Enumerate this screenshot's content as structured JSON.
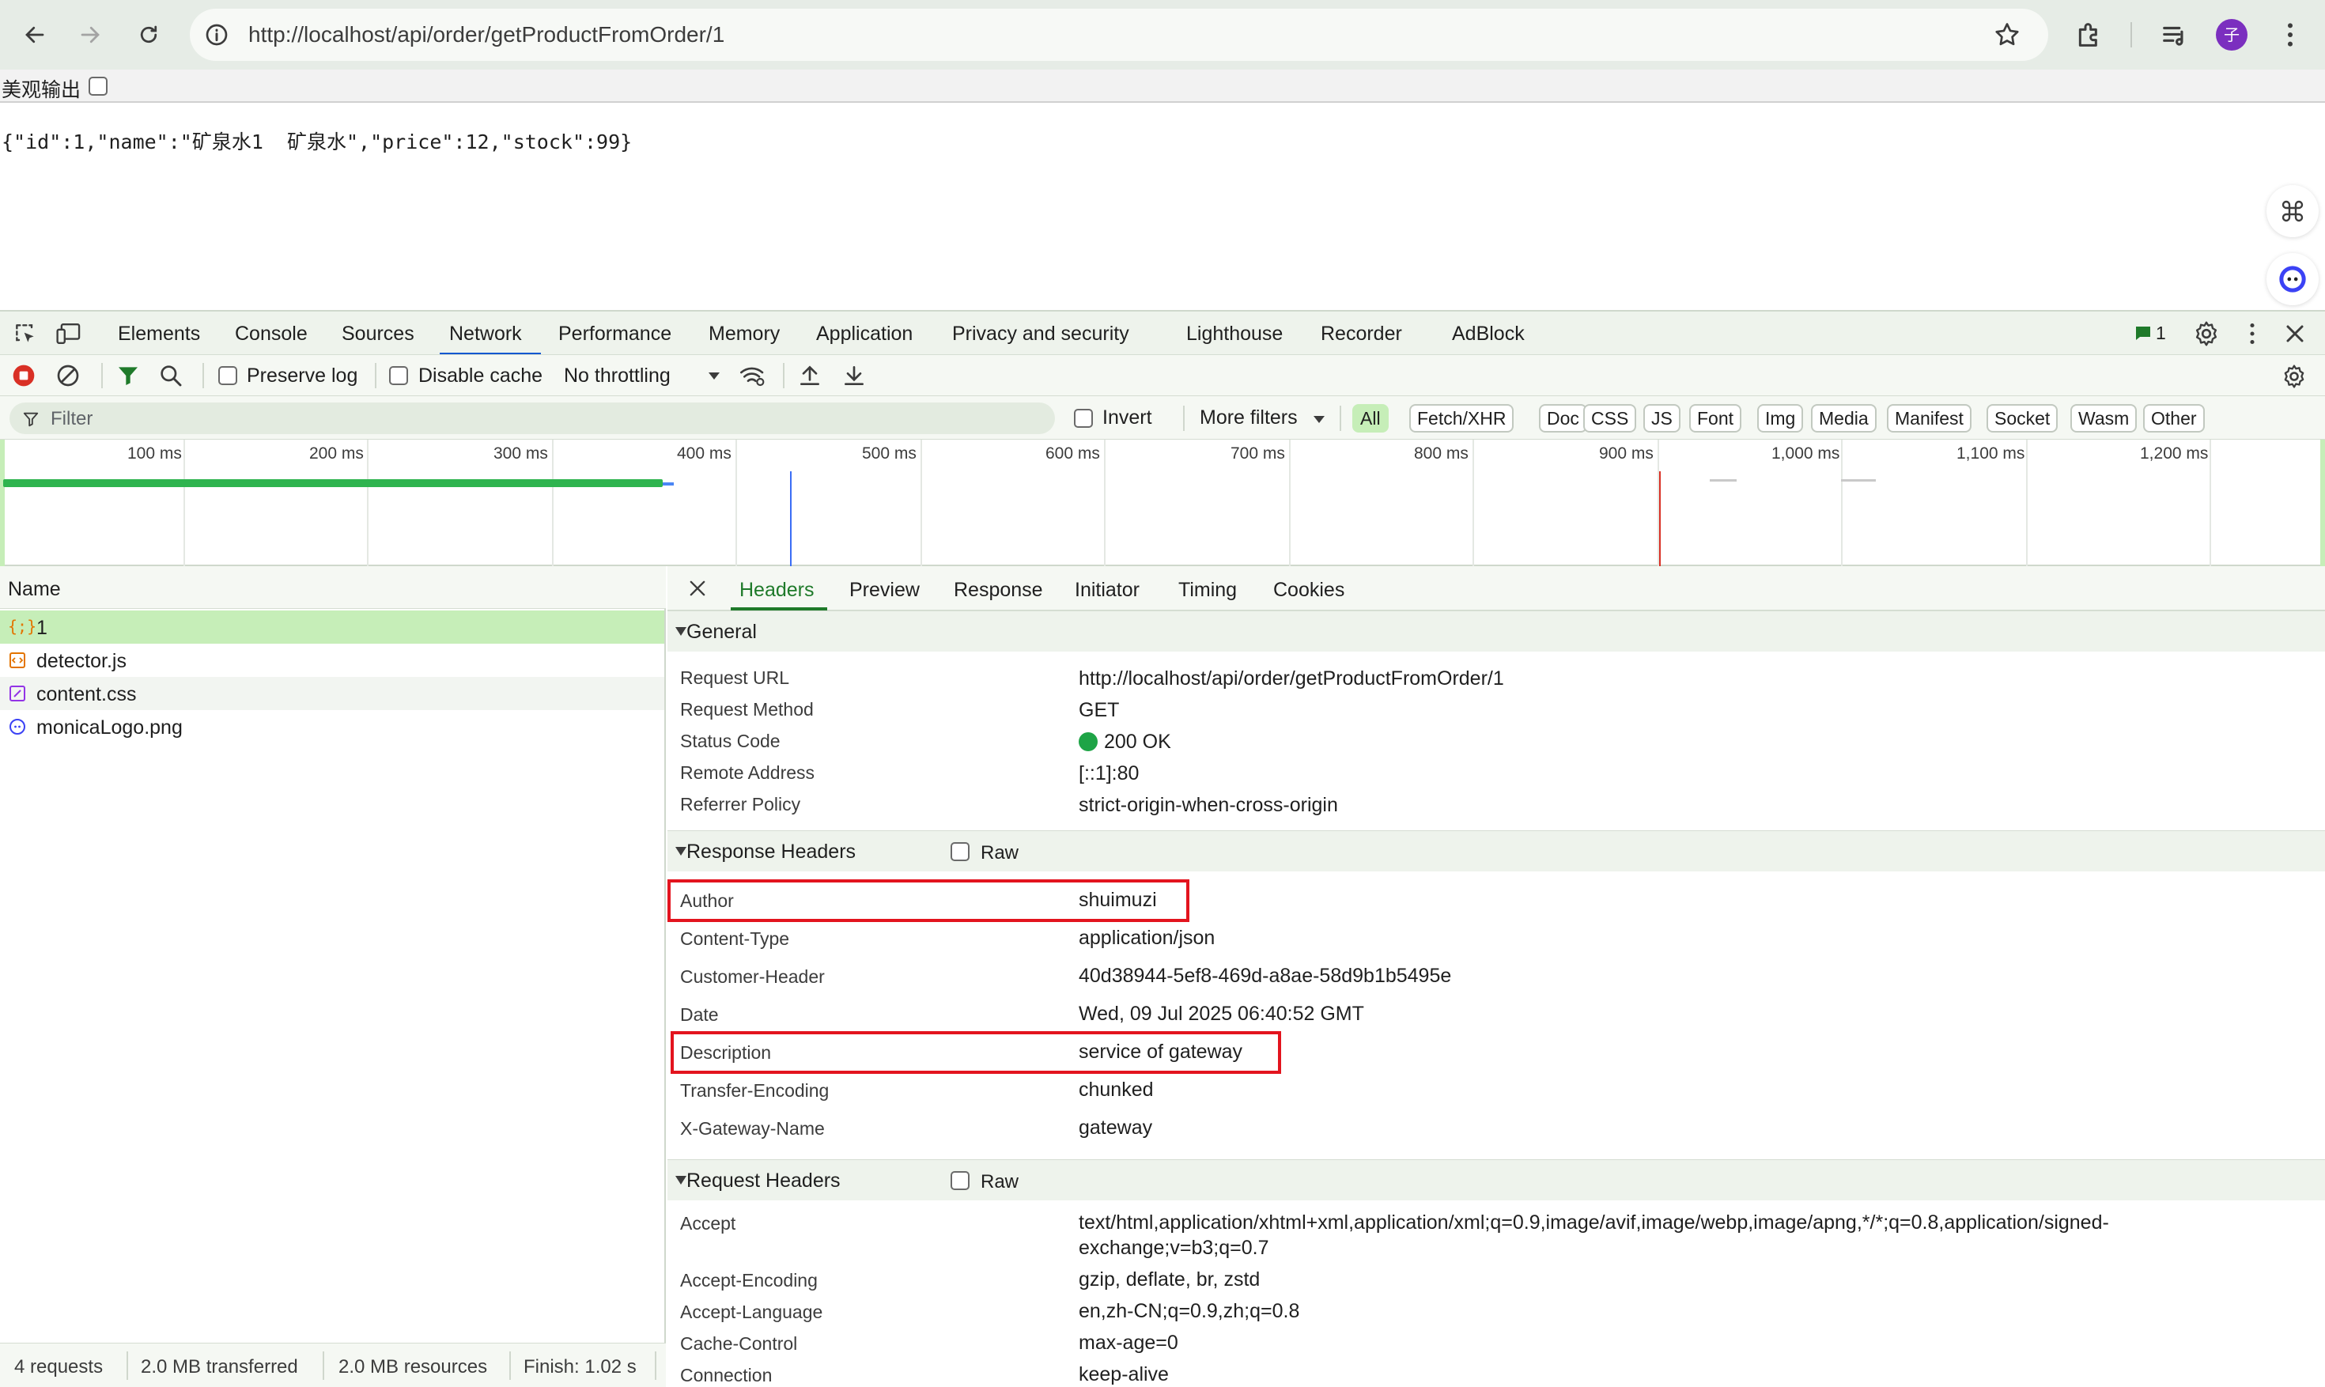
{
  "browser": {
    "url": "http://localhost/api/order/getProductFromOrder/1",
    "profile_initial": "子"
  },
  "page": {
    "pretty_print_label": "美观输出",
    "json_text": "{\"id\":1,\"name\":\"矿泉水1  矿泉水\",\"price\":12,\"stock\":99}"
  },
  "devtools": {
    "tabs": [
      "Elements",
      "Console",
      "Sources",
      "Network",
      "Performance",
      "Memory",
      "Application",
      "Privacy and security",
      "Lighthouse",
      "Recorder",
      "AdBlock"
    ],
    "active_tab": "Network",
    "issues_count": "1",
    "toolbar": {
      "preserve_log": "Preserve log",
      "disable_cache": "Disable cache",
      "throttling": "No throttling"
    },
    "filter": {
      "placeholder": "Filter",
      "invert": "Invert",
      "more_filters": "More filters",
      "chips": [
        "All",
        "Fetch/XHR",
        "Doc",
        "CSS",
        "JS",
        "Font",
        "Img",
        "Media",
        "Manifest",
        "Socket",
        "Wasm",
        "Other"
      ],
      "active_chip": "All"
    },
    "timeline_ticks": [
      "100 ms",
      "200 ms",
      "300 ms",
      "400 ms",
      "500 ms",
      "600 ms",
      "700 ms",
      "800 ms",
      "900 ms",
      "1,000 ms",
      "1,100 ms",
      "1,200 ms"
    ],
    "requests": {
      "column": "Name",
      "items": [
        {
          "name": "1",
          "icon": "json-icon",
          "selected": true
        },
        {
          "name": "detector.js",
          "icon": "script-icon",
          "selected": false
        },
        {
          "name": "content.css",
          "icon": "stylesheet-icon",
          "selected": false
        },
        {
          "name": "monicaLogo.png",
          "icon": "image-icon",
          "selected": false
        }
      ]
    },
    "summary": {
      "requests": "4 requests",
      "transferred": "2.0 MB transferred",
      "resources": "2.0 MB resources",
      "finish": "Finish: 1.02 s"
    },
    "detail_tabs": [
      "Headers",
      "Preview",
      "Response",
      "Initiator",
      "Timing",
      "Cookies"
    ],
    "active_detail_tab": "Headers",
    "general": {
      "title": "General",
      "rows": [
        {
          "key": "Request URL",
          "value": "http://localhost/api/order/getProductFromOrder/1"
        },
        {
          "key": "Request Method",
          "value": "GET"
        },
        {
          "key": "Status Code",
          "value": "200 OK"
        },
        {
          "key": "Remote Address",
          "value": "[::1]:80"
        },
        {
          "key": "Referrer Policy",
          "value": "strict-origin-when-cross-origin"
        }
      ]
    },
    "response_headers": {
      "title": "Response Headers",
      "raw": "Raw",
      "rows": [
        {
          "key": "Author",
          "value": "shuimuzi"
        },
        {
          "key": "Content-Type",
          "value": "application/json"
        },
        {
          "key": "Customer-Header",
          "value": "40d38944-5ef8-469d-a8ae-58d9b1b5495e"
        },
        {
          "key": "Date",
          "value": "Wed, 09 Jul 2025 06:40:52 GMT"
        },
        {
          "key": "Description",
          "value": "service of gateway"
        },
        {
          "key": "Transfer-Encoding",
          "value": "chunked"
        },
        {
          "key": "X-Gateway-Name",
          "value": "gateway"
        }
      ]
    },
    "request_headers": {
      "title": "Request Headers",
      "raw": "Raw",
      "rows": [
        {
          "key": "Accept",
          "value": "text/html,application/xhtml+xml,application/xml;q=0.9,image/avif,image/webp,image/apng,*/*;q=0.8,application/signed-",
          "value_cont": "exchange;v=b3;q=0.7"
        },
        {
          "key": "Accept-Encoding",
          "value": "gzip, deflate, br, zstd"
        },
        {
          "key": "Accept-Language",
          "value": "en,zh-CN;q=0.9,zh;q=0.8"
        },
        {
          "key": "Cache-Control",
          "value": "max-age=0"
        },
        {
          "key": "Connection",
          "value": "keep-alive"
        }
      ]
    },
    "colors": {
      "accent": "#0b57d0",
      "selected_row": "#c6eeb8",
      "status_ok": "#1ea446",
      "highlight": "#e3141e"
    }
  }
}
